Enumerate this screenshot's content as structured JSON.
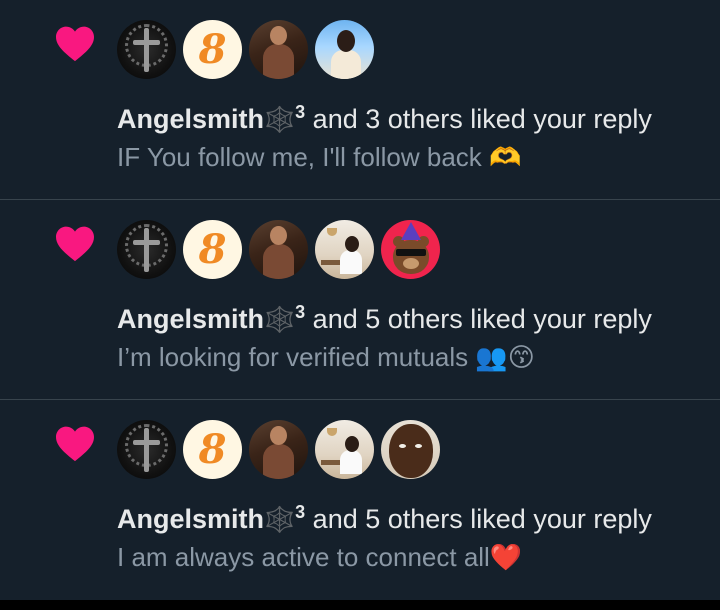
{
  "notifications": [
    {
      "actor_name": "Angelsmith",
      "actor_decoration": "🕸️",
      "actor_superscript": "3",
      "action_text": " and 3 others liked your reply",
      "reply_snippet": "IF You follow me, I'll follow back 🫶",
      "avatars": [
        "rosary-avatar",
        "logo-avatar",
        "woman-portrait-avatar",
        "beach-portrait-avatar"
      ]
    },
    {
      "actor_name": "Angelsmith",
      "actor_decoration": "🕸️",
      "actor_superscript": "3",
      "action_text": " and 5 others liked your reply",
      "reply_snippet": "I’m looking for verified mutuals 👥😙",
      "avatars": [
        "rosary-avatar",
        "logo-avatar",
        "woman-portrait-avatar",
        "cafe-portrait-avatar",
        "bear-avatar"
      ]
    },
    {
      "actor_name": "Angelsmith",
      "actor_decoration": "🕸️",
      "actor_superscript": "3",
      "action_text": " and 5 others liked your reply",
      "reply_snippet": "I am always active to connect all❤️",
      "avatars": [
        "rosary-avatar",
        "logo-avatar",
        "woman-portrait-avatar",
        "cafe-portrait-avatar",
        "man-portrait-avatar"
      ]
    }
  ],
  "icons": {
    "like": "heart-icon"
  },
  "colors": {
    "background": "#15202b",
    "heart": "#f91880",
    "divider": "#38444d",
    "primary_text": "#e7e9ea",
    "secondary_text": "#8b98a5"
  }
}
